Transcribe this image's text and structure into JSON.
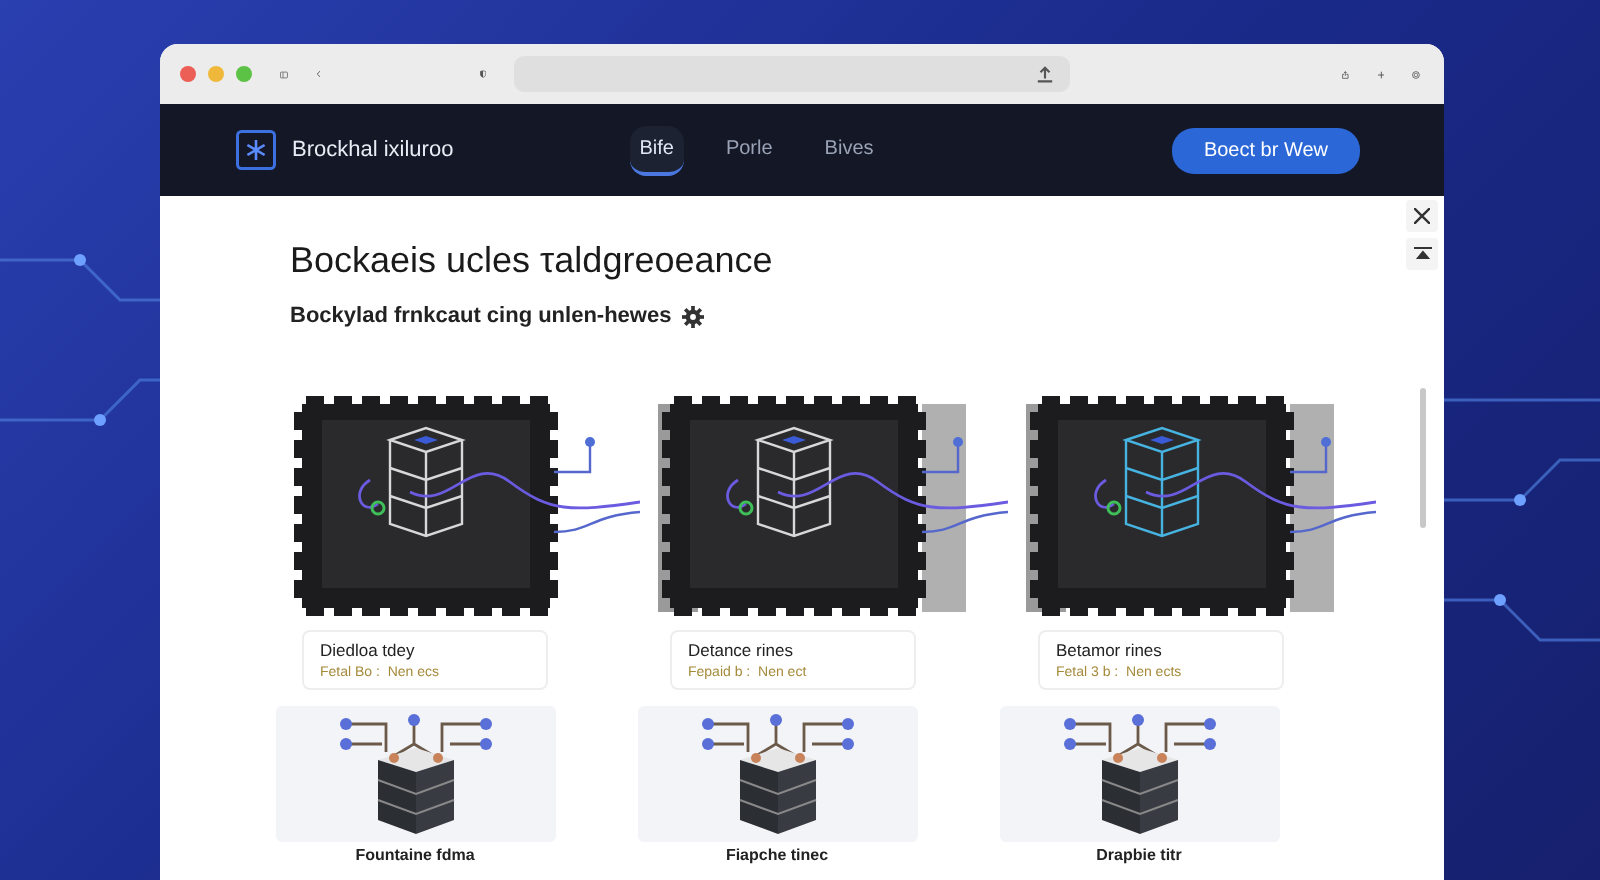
{
  "navbar": {
    "brand": "Brockhal ixiluroo",
    "tabs": [
      {
        "label": "Bife",
        "selected": true
      },
      {
        "label": "Porle",
        "selected": false
      },
      {
        "label": "Bives",
        "selected": false
      }
    ],
    "button": "Boect br Wew"
  },
  "heading": "Bockaeis ucles τaldgreoeance",
  "subheading": "Bockylad frnkcaut cing unlen-hewes",
  "nodes": [
    {
      "title": "Diedloa tdey",
      "subtitle": "Fetal Bo :  Nen ecs"
    },
    {
      "title": "Detance rines",
      "subtitle": "Fepaid b :  Nen ect"
    },
    {
      "title": "Betamor rines",
      "subtitle": "Fetal 3 b :  Nen ects"
    }
  ],
  "servers": [
    {
      "caption": "Fountaine fdma"
    },
    {
      "caption": "Fiapche tinec"
    },
    {
      "caption": "Drapbie titr"
    }
  ]
}
